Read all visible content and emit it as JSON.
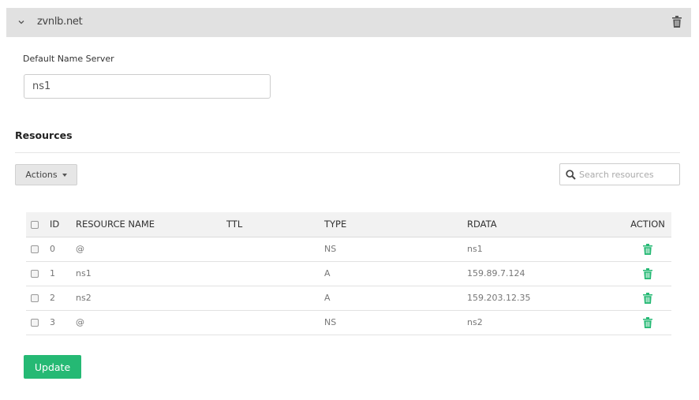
{
  "panel": {
    "domain": "zvnlb.net",
    "collapse_icon": "chevron-down-icon",
    "delete_icon": "trash-icon"
  },
  "name_server": {
    "label": "Default Name Server",
    "value": "ns1"
  },
  "resources": {
    "heading": "Resources",
    "actions_label": "Actions",
    "search_placeholder": "Search resources",
    "columns": {
      "id": "ID",
      "name": "RESOURCE NAME",
      "ttl": "TTL",
      "type": "TYPE",
      "rdata": "RDATA",
      "action": "ACTION"
    },
    "rows": [
      {
        "id": "0",
        "name": "@",
        "ttl": "",
        "type": "NS",
        "rdata": "ns1"
      },
      {
        "id": "1",
        "name": "ns1",
        "ttl": "",
        "type": "A",
        "rdata": "159.89.7.124"
      },
      {
        "id": "2",
        "name": "ns2",
        "ttl": "",
        "type": "A",
        "rdata": "159.203.12.35"
      },
      {
        "id": "3",
        "name": "@",
        "ttl": "",
        "type": "NS",
        "rdata": "ns2"
      }
    ]
  },
  "update_label": "Update",
  "colors": {
    "accent_green": "#25b974",
    "header_bg": "#e1e1e1"
  }
}
